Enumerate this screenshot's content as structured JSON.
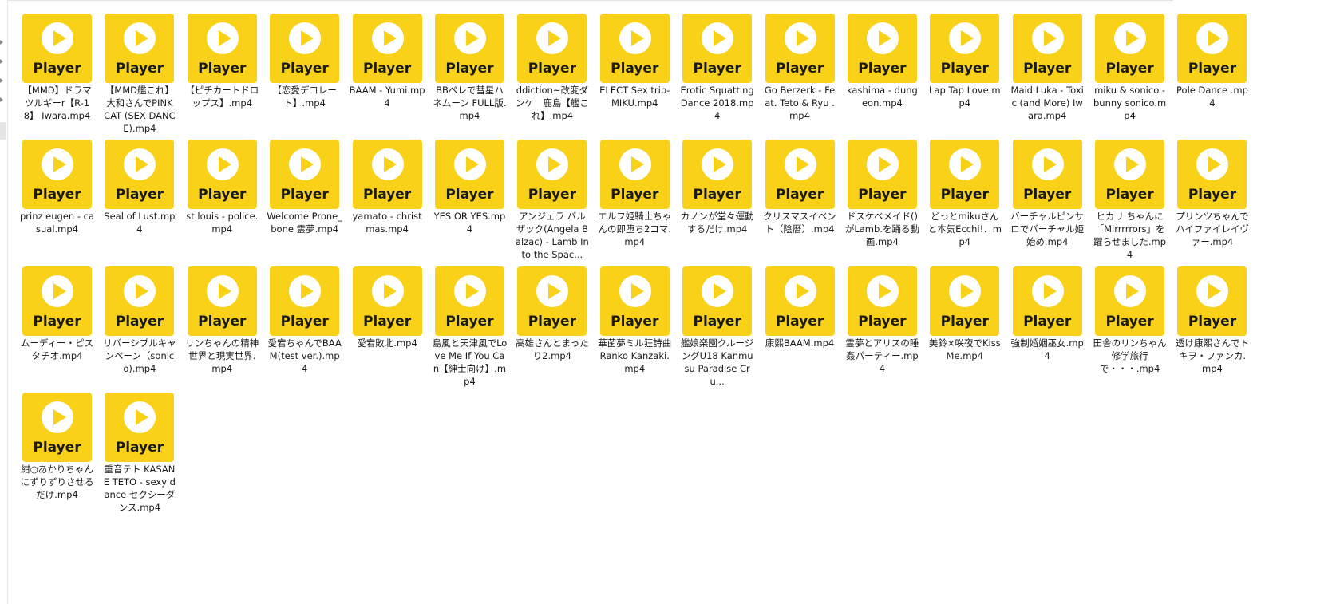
{
  "icon_label": "Player",
  "icon_color": "#f8d118",
  "icon_name": "video-player-icon",
  "files": [
    "【MMD】ドラマツルギーr【R-18】 Iwara.mp4",
    "【MMD艦これ】大和さんでPINK CAT (SEX DANCE).mp4",
    "【ピチカートドロップス】.mp4",
    "【恋愛デコレート】.mp4",
    "BAAM - Yumi.mp4",
    "BBペレで彗星ハネムーン FULL版.mp4",
    "ddiction~改変ダンケ　鹿島【艦これ】.mp4",
    "ELECT Sex trip-MIKU.mp4",
    "Erotic Squatting Dance 2018.mp4",
    "Go Berzerk - Feat. Teto & Ryu .mp4",
    "kashima - dungeon.mp4",
    "Lap Tap Love.mp4",
    "Maid Luka - Toxic (and More) Iwara.mp4",
    "miku & sonico - bunny sonico.mp4",
    "Pole Dance .mp4",
    "prinz eugen - casual.mp4",
    "Seal of Lust.mp4",
    "st.louis - police.mp4",
    "Welcome Prone_bone 霊夢.mp4",
    "yamato - christmas.mp4",
    "YES OR YES.mp4",
    "アンジェラ バルザック(Angela Balzac) - Lamb Into the Spac...",
    "エルフ姫騎士ちゃんの即堕ち2コマ.mp4",
    "カノンが堂々運動するだけ.mp4",
    "クリスマスイベント（陰暦）.mp4",
    "ドスケベメイド()がLamb.を踊る動画.mp4",
    "どっとmikuさんと本気Ecchi!．mp4",
    "バーチャルピンサロでバーチャル姫始め.mp4",
    "ヒカリ ちゃんに「Mirrrrrors」を躍らせました.mp4",
    "プリンツちゃんでハイファイレイヴァー.mp4",
    "ムーディー・ピスタチオ.mp4",
    "リバーシブルキャンペーン（sonico).mp4",
    "リンちゃんの精神世界と現実世界.mp4",
    "愛宕ちゃんでBAAM(test ver.).mp4",
    "愛宕敗北.mp4",
    "島風と天津風でLove Me If You Can【紳士向け】.mp4",
    "高雄さんとまったり2.mp4",
    "華菌夢ミル狂詩曲 Ranko Kanzaki.mp4",
    "艦娘楽園クルージングU18 Kanmusu Paradise Cru...",
    "康熙BAAM.mp4",
    "霊夢とアリスの睡姦パーティー.mp4",
    "美鈴×咲夜でKiss Me.mp4",
    "強制婚姻巫女.mp4",
    "田舎のリンちゃん　修学旅行で・・・.mp4",
    "透け康熙さんでトキヲ・ファンカ.mp4",
    "紺○あかりちゃんにずりずりさせるだけ.mp4",
    "重音テト KASANE TETO - sexy dance セクシーダンス.mp4"
  ]
}
